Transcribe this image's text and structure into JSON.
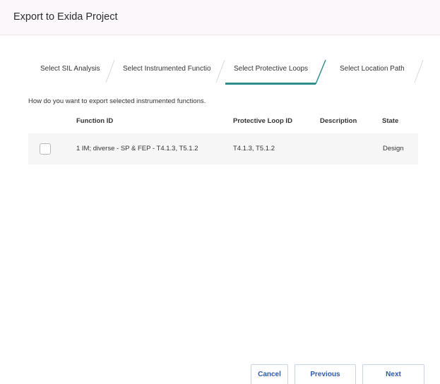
{
  "dialog": {
    "title": "Export to Exida Project"
  },
  "wizard": {
    "steps": [
      {
        "label": "Select SIL Analysis",
        "active": false
      },
      {
        "label": "Select Instrumented Functio...",
        "active": false
      },
      {
        "label": "Select Protective Loops",
        "active": true
      },
      {
        "label": "Select Location Path",
        "active": false
      }
    ],
    "accent_color": "#2f8f8d"
  },
  "content": {
    "question": "How do you want to export selected instrumented functions."
  },
  "table": {
    "headers": {
      "function_id": "Function ID",
      "protective_loop_id": "Protective Loop ID",
      "description": "Description",
      "state": "State"
    },
    "rows": [
      {
        "checked": false,
        "function_id": "1 IM; diverse - SP & FEP - T4.1.3, T5.1.2",
        "protective_loop_id": "T4.1.3, T5.1.2",
        "description": "",
        "state": "Design"
      }
    ]
  },
  "footer": {
    "cancel_label": "Cancel",
    "previous_label": "Previous",
    "next_label": "Next",
    "button_text_color": "#2d5aa8"
  }
}
